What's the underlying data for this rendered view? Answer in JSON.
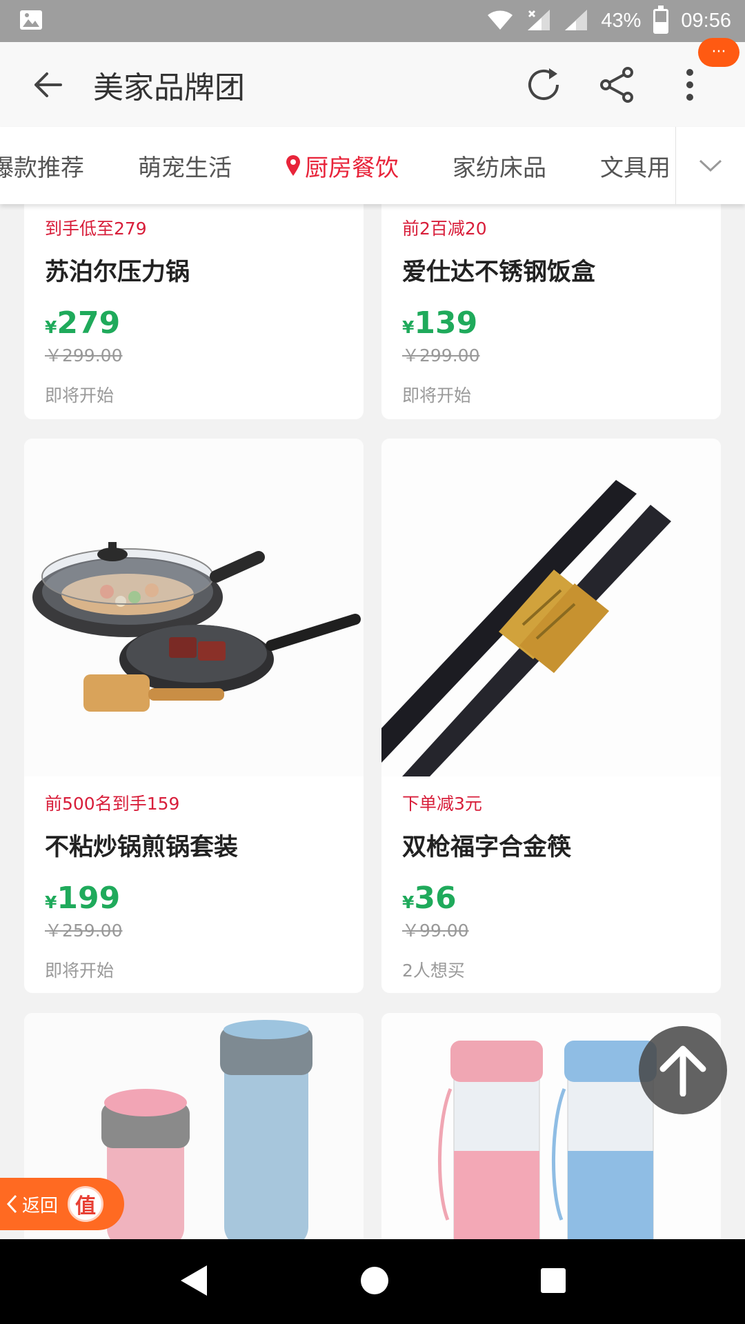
{
  "status_bar": {
    "battery": "43%",
    "time": "09:56"
  },
  "header": {
    "title": "美家品牌团",
    "more_badge": "···"
  },
  "tabs": [
    {
      "label": "爆款推荐",
      "active": false
    },
    {
      "label": "萌宠生活",
      "active": false
    },
    {
      "label": "厨房餐饮",
      "active": true
    },
    {
      "label": "家纺床品",
      "active": false
    },
    {
      "label": "文具用",
      "active": false
    }
  ],
  "products": [
    {
      "promo": "到手低至279",
      "name": "苏泊尔压力锅",
      "yen": "¥",
      "price": "279",
      "original": "￥299.00",
      "status": "即将开始"
    },
    {
      "promo": "前2百减20",
      "name": "爱仕达不锈钢饭盒",
      "yen": "¥",
      "price": "139",
      "original": "￥299.00",
      "status": "即将开始"
    },
    {
      "promo": "前500名到手159",
      "name": "不粘炒锅煎锅套装",
      "yen": "¥",
      "price": "199",
      "original": "￥259.00",
      "status": "即将开始"
    },
    {
      "promo": "下单减3元",
      "name": "双枪福字合金筷",
      "yen": "¥",
      "price": "36",
      "original": "￥99.00",
      "status": "2人想买"
    }
  ],
  "floating": {
    "return_label": "返回",
    "return_badge": "值"
  },
  "colors": {
    "accent_red": "#e8243a",
    "price_green": "#1faa5b",
    "badge_orange": "#ff5a12"
  }
}
